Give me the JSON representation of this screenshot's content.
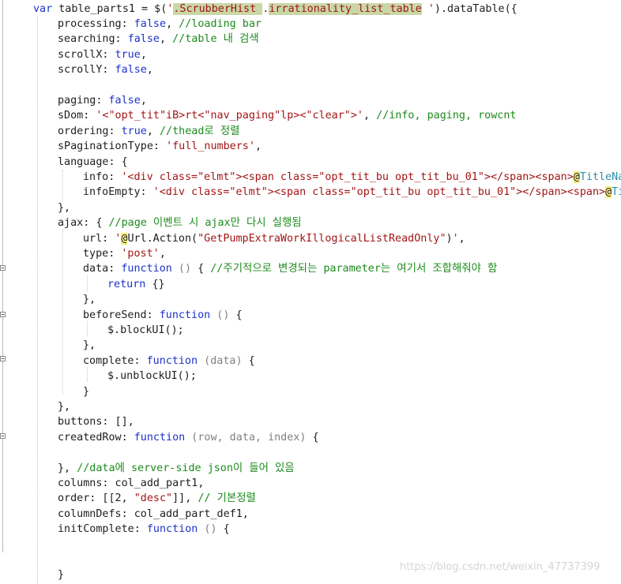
{
  "editor": {
    "lines": [
      [
        [
          "kw",
          "var "
        ],
        [
          "",
          "table_parts1 = $("
        ],
        [
          "str",
          "'"
        ],
        [
          "hl-sel str",
          ".ScrubberHist "
        ],
        [
          "str",
          "."
        ],
        [
          "hl-sel str",
          "irrationality_list_table"
        ],
        [
          "str",
          " '"
        ],
        [
          "",
          ").dataTable({"
        ]
      ],
      [
        [
          "",
          "processing: "
        ],
        [
          "kw",
          "false"
        ],
        [
          "",
          ", "
        ],
        [
          "cmt",
          "//loading bar"
        ]
      ],
      [
        [
          "",
          "searching: "
        ],
        [
          "kw",
          "false"
        ],
        [
          "",
          ", "
        ],
        [
          "cmt",
          "//table 내 검색"
        ]
      ],
      [
        [
          "",
          "scrollX: "
        ],
        [
          "kw",
          "true"
        ],
        [
          "",
          ","
        ]
      ],
      [
        [
          "",
          "scrollY: "
        ],
        [
          "kw",
          "false"
        ],
        [
          "",
          ","
        ]
      ],
      [],
      [
        [
          "",
          "paging: "
        ],
        [
          "kw",
          "false"
        ],
        [
          "",
          ","
        ]
      ],
      [
        [
          "",
          "sDom: "
        ],
        [
          "str",
          "'<\"opt_tit\"iB>rt<\"nav_paging\"lp><\"clear\">'"
        ],
        [
          "",
          ", "
        ],
        [
          "cmt",
          "//info, paging, rowcnt"
        ]
      ],
      [
        [
          "",
          "ordering: "
        ],
        [
          "kw",
          "true"
        ],
        [
          "",
          ", "
        ],
        [
          "cmt",
          "//thead로 정렬"
        ]
      ],
      [
        [
          "",
          "sPaginationType: "
        ],
        [
          "str",
          "'full_numbers'"
        ],
        [
          "",
          ","
        ]
      ],
      [
        [
          "",
          "language: {"
        ]
      ],
      [
        [
          "",
          "info: "
        ],
        [
          "str",
          "'<div class=\"elmt\"><span class=\"opt_tit_bu opt_tit_bu_01\"></span><span>"
        ],
        [
          "hl-razor",
          "@"
        ],
        [
          "hl-ref",
          "TitleName"
        ]
      ],
      [
        [
          "",
          "infoEmpty: "
        ],
        [
          "str",
          "'<div class=\"elmt\"><span class=\"opt_tit_bu opt_tit_bu_01\"></span><span>"
        ],
        [
          "hl-razor",
          "@"
        ],
        [
          "hl-ref",
          "Titl"
        ]
      ],
      [
        [
          "",
          "},"
        ]
      ],
      [
        [
          "",
          "ajax: { "
        ],
        [
          "cmt",
          "//page 이벤트 시 ajax만 다시 실행됨"
        ]
      ],
      [
        [
          "",
          "url: "
        ],
        [
          "str",
          "'"
        ],
        [
          "hl-razor",
          "@"
        ],
        [
          "",
          "Url.Action("
        ],
        [
          "str",
          "\"GetPumpExtraWorkIllogicalListReadOnly\""
        ],
        [
          "",
          ")"
        ],
        [
          "str",
          "'"
        ],
        [
          "",
          ","
        ]
      ],
      [
        [
          "",
          "type: "
        ],
        [
          "str",
          "'post'"
        ],
        [
          "",
          ","
        ]
      ],
      [
        [
          "",
          "data: "
        ],
        [
          "kw",
          "function"
        ],
        [
          "prm",
          " () "
        ],
        [
          "",
          "{ "
        ],
        [
          "cmt",
          "//주기적으로 변경되는 parameter는 여기서 조합해줘야 함"
        ]
      ],
      [
        [
          "kw",
          "return "
        ],
        [
          "",
          "{}"
        ]
      ],
      [
        [
          "",
          "},"
        ]
      ],
      [
        [
          "",
          "beforeSend: "
        ],
        [
          "kw",
          "function"
        ],
        [
          "prm",
          " () "
        ],
        [
          "",
          "{"
        ]
      ],
      [
        [
          "",
          "$.blockUI();"
        ]
      ],
      [
        [
          "",
          "},"
        ]
      ],
      [
        [
          "",
          "complete: "
        ],
        [
          "kw",
          "function"
        ],
        [
          "prm",
          " (data) "
        ],
        [
          "",
          "{"
        ]
      ],
      [
        [
          "",
          "$.unblockUI();"
        ]
      ],
      [
        [
          "",
          "}"
        ]
      ],
      [
        [
          "",
          "},"
        ]
      ],
      [
        [
          "",
          "buttons: [],"
        ]
      ],
      [
        [
          "",
          "createdRow: "
        ],
        [
          "kw",
          "function"
        ],
        [
          "prm",
          " (row, data, index) "
        ],
        [
          "",
          "{"
        ]
      ],
      [],
      [
        [
          "",
          "}, "
        ],
        [
          "cmt",
          "//data에 server-side json이 들어 있음"
        ]
      ],
      [
        [
          "",
          "columns: col_add_part1,"
        ]
      ],
      [
        [
          "",
          "order: [[2, "
        ],
        [
          "str",
          "\"desc\""
        ],
        [
          "",
          "]], "
        ],
        [
          "cmt",
          "// 기본정렬"
        ]
      ],
      [
        [
          "",
          "columnDefs: col_add_part_def1,"
        ]
      ],
      [
        [
          "",
          "initComplete: "
        ],
        [
          "kw",
          "function"
        ],
        [
          "prm",
          " () "
        ],
        [
          "",
          "{"
        ]
      ],
      [],
      [],
      [
        [
          "",
          "}"
        ]
      ]
    ]
  },
  "watermark": "https://blog.csdn.net/weixin_47737399"
}
